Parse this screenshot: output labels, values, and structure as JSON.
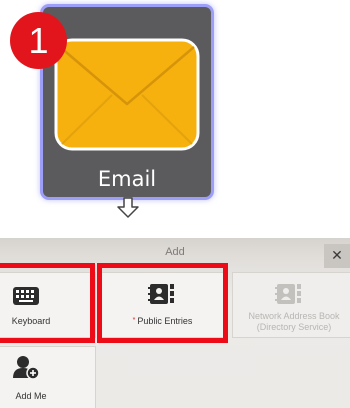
{
  "step": {
    "number": "1"
  },
  "email_tile": {
    "label": "Email"
  },
  "dialog": {
    "title": "Add",
    "close_glyph": "✕",
    "options": [
      {
        "label": "Keyboard",
        "icon": "keyboard-icon",
        "enabled": true,
        "highlighted": true
      },
      {
        "label": "Public Entries",
        "required_marker": "*",
        "icon": "address-book-icon",
        "enabled": true,
        "highlighted": true
      },
      {
        "label_line1": "Network Address Book",
        "label_line2": "(Directory Service)",
        "icon": "network-address-book-icon",
        "enabled": false
      },
      {
        "label": "Add Me",
        "icon": "add-person-icon",
        "enabled": true
      }
    ]
  },
  "colors": {
    "highlight": "#ec0b16",
    "badge": "#e2151c",
    "envelope": "#f6b10f",
    "tile_bg": "#5b5b5d",
    "tile_glow": "#9d9ef7"
  }
}
